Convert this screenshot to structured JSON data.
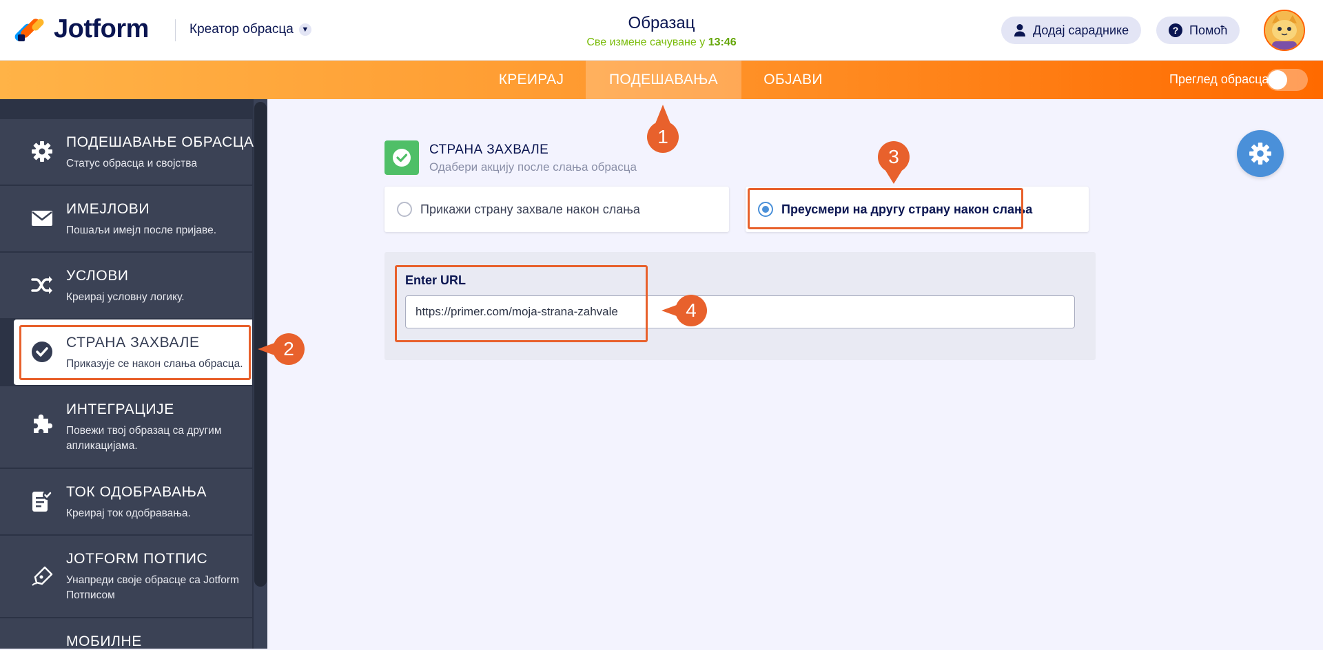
{
  "header": {
    "brand": "Jotform",
    "creator_label": "Креатор обрасца",
    "form_title": "Образац",
    "saved_text": "Све измене сачуване у",
    "saved_time": "13:46",
    "add_collaborators": "Додај сараднике",
    "help": "Помоћ"
  },
  "nav": {
    "tabs": [
      {
        "label": "КРЕИРАЈ"
      },
      {
        "label": "ПОДЕШАВАЊА",
        "active": true
      },
      {
        "label": "ОБЈАВИ"
      }
    ],
    "preview_label": "Преглед обрасца",
    "preview_on": false
  },
  "sidebar": {
    "items": [
      {
        "title": "ПОДЕШАВАЊЕ ОБРАСЦА",
        "desc": "Статус обрасца и својства",
        "icon": "gear-icon"
      },
      {
        "title": "ИМЕЈЛОВИ",
        "desc": "Пошаљи имејл после пријаве.",
        "icon": "envelope-icon"
      },
      {
        "title": "УСЛОВИ",
        "desc": "Креирај условну логику.",
        "icon": "shuffle-icon"
      },
      {
        "title": "СТРАНА ЗАХВАЛЕ",
        "desc": "Приказује се након слања обрасца.",
        "icon": "check-circle-icon",
        "selected": true
      },
      {
        "title": "ИНТЕГРАЦИЈЕ",
        "desc": "Повежи твој образац са другим апликацијама.",
        "icon": "puzzle-icon"
      },
      {
        "title": "ТОК ОДОБРАВАЊА",
        "desc": "Креирај ток одобравања.",
        "icon": "approval-icon"
      },
      {
        "title": "JOTFORM ПОТПИС",
        "desc": "Унапреди своје обрасце са Jotform Потписом",
        "icon": "signature-pen-icon"
      },
      {
        "title": "МОБИЛНЕ",
        "desc": "",
        "icon": ""
      }
    ]
  },
  "main": {
    "section_title": "СТРАНА ЗАХВАЛЕ",
    "section_subtitle": "Одабери акцију после слања обрасца",
    "option_show": "Прикажи страну захвале након слања",
    "option_redirect": "Преусмери на другу страну након слања",
    "selected_option": "redirect",
    "url_label": "Enter URL",
    "url_value": "https://primer.com/moja-strana-zahvale"
  },
  "annotations": {
    "markers": [
      "1",
      "2",
      "3",
      "4"
    ],
    "color": "#e8612c"
  },
  "colors": {
    "brand_navy": "#0a1551",
    "nav_orange": "#ff6a00",
    "sidebar_bg": "#2c3345",
    "accent_blue": "#4a90d9",
    "success_green": "#4fbf67"
  }
}
